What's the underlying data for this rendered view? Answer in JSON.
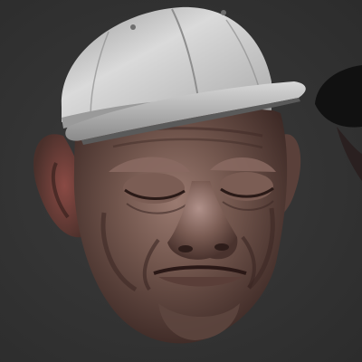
{
  "scene": {
    "subject": "sculpted-head-with-cap",
    "colors": {
      "background": "#333333",
      "skin": "#6e5249",
      "skin_highlight": "#a48479",
      "skin_shadow": "#3a2723",
      "cap": "#c9c9c9",
      "cap_shadow": "#7d7d7d",
      "visor_dark": "#161616"
    }
  }
}
